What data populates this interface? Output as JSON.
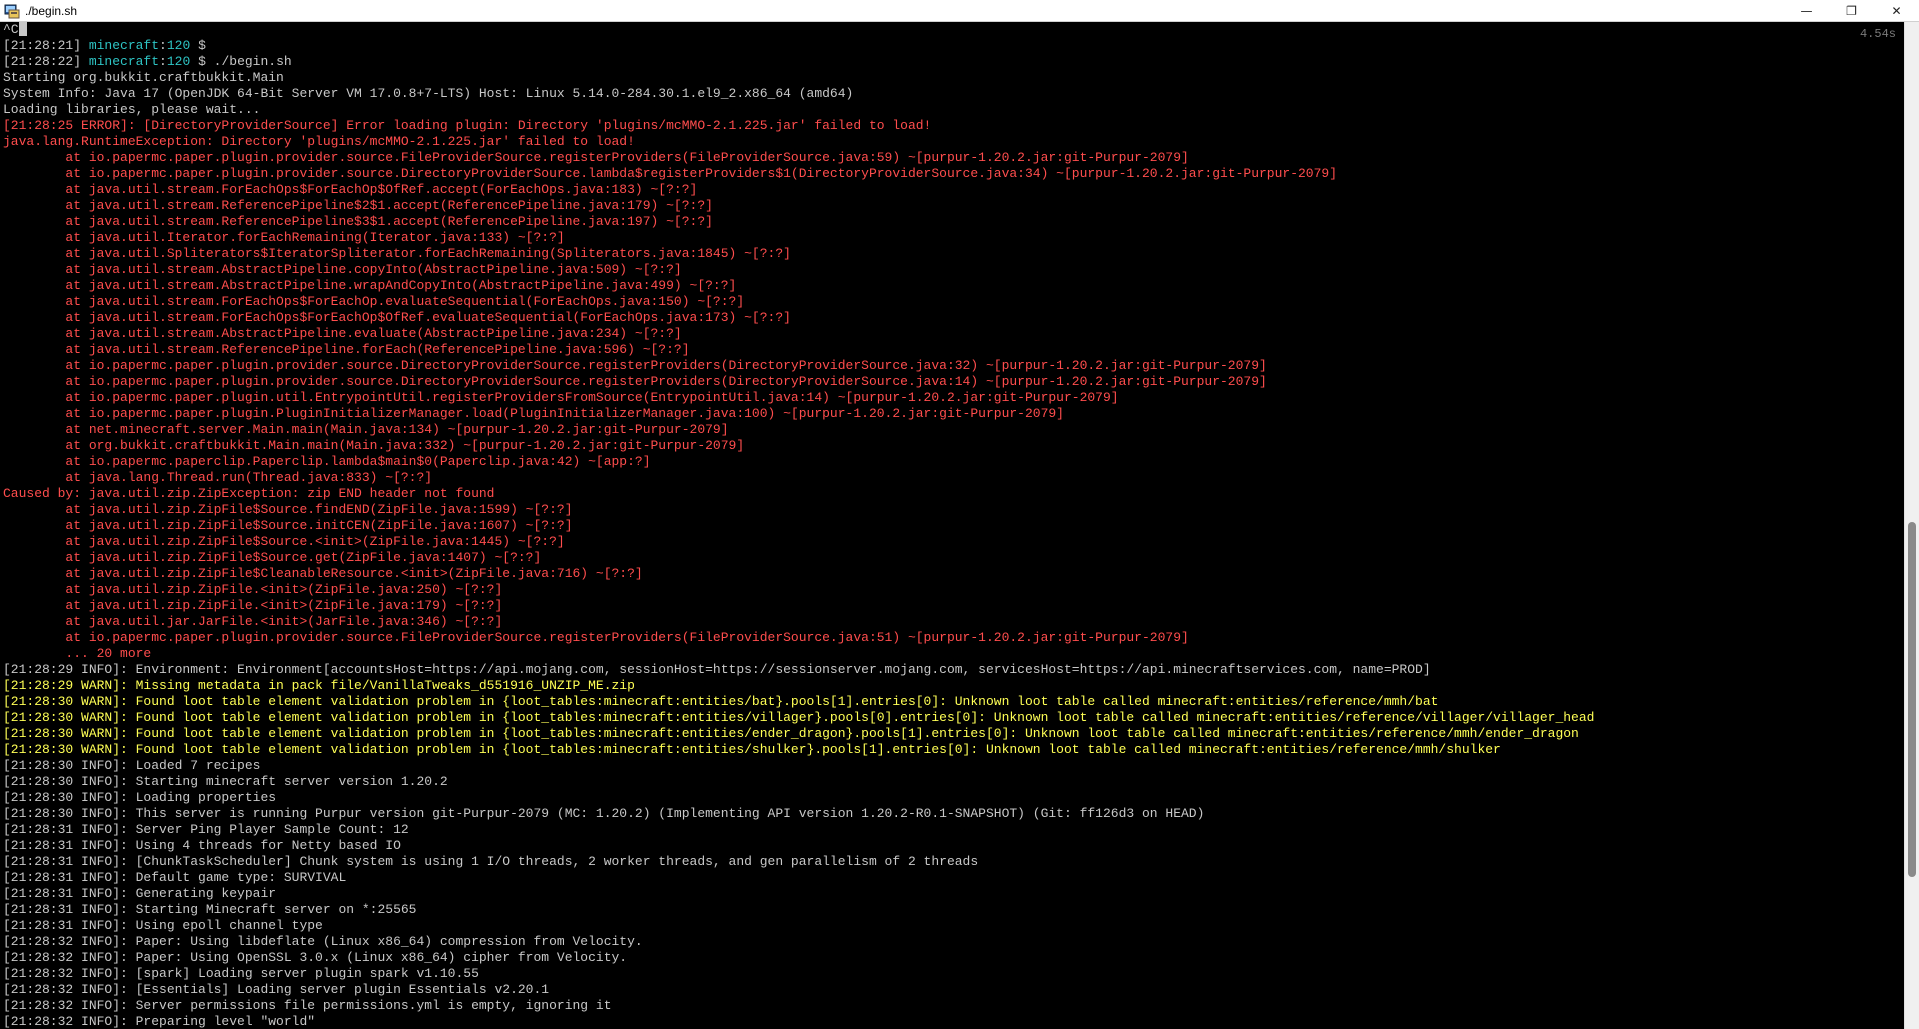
{
  "window": {
    "title": "./begin.sh",
    "minimize_glyph": "—",
    "maximize_glyph": "❐",
    "close_glyph": "✕"
  },
  "terminal": {
    "timer": "4.54s",
    "cursor_text": "^C",
    "lines": [
      {
        "segments": [
          {
            "t": "[21:28:21] ",
            "c": "default"
          },
          {
            "t": "minecraft",
            "c": "host"
          },
          {
            "t": ":",
            "c": "default"
          },
          {
            "t": "120",
            "c": "host"
          },
          {
            "t": " $",
            "c": "default"
          }
        ]
      },
      {
        "segments": [
          {
            "t": "[21:28:22] ",
            "c": "default"
          },
          {
            "t": "minecraft",
            "c": "host"
          },
          {
            "t": ":",
            "c": "default"
          },
          {
            "t": "120",
            "c": "host"
          },
          {
            "t": " $ ./begin.sh",
            "c": "default"
          }
        ]
      },
      {
        "segments": [
          {
            "t": "Starting org.bukkit.craftbukkit.Main",
            "c": "default"
          }
        ]
      },
      {
        "segments": [
          {
            "t": "System Info: Java 17 (OpenJDK 64-Bit Server VM 17.0.8+7-LTS) Host: Linux 5.14.0-284.30.1.el9_2.x86_64 (amd64)",
            "c": "default"
          }
        ]
      },
      {
        "segments": [
          {
            "t": "Loading libraries, please wait...",
            "c": "default"
          }
        ]
      },
      {
        "segments": [
          {
            "t": "[21:28:25 ERROR]: [DirectoryProviderSource] Error loading plugin: Directory 'plugins/mcMMO-2.1.225.jar' failed to load!",
            "c": "error"
          }
        ]
      },
      {
        "segments": [
          {
            "t": "java.lang.RuntimeException: Directory 'plugins/mcMMO-2.1.225.jar' failed to load!",
            "c": "error"
          }
        ]
      },
      {
        "segments": [
          {
            "t": "        at io.papermc.paper.plugin.provider.source.FileProviderSource.registerProviders(FileProviderSource.java:59) ~[purpur-1.20.2.jar:git-Purpur-2079]",
            "c": "error"
          }
        ]
      },
      {
        "segments": [
          {
            "t": "        at io.papermc.paper.plugin.provider.source.DirectoryProviderSource.lambda$registerProviders$1(DirectoryProviderSource.java:34) ~[purpur-1.20.2.jar:git-Purpur-2079]",
            "c": "error"
          }
        ]
      },
      {
        "segments": [
          {
            "t": "        at java.util.stream.ForEachOps$ForEachOp$OfRef.accept(ForEachOps.java:183) ~[?:?]",
            "c": "error"
          }
        ]
      },
      {
        "segments": [
          {
            "t": "        at java.util.stream.ReferencePipeline$2$1.accept(ReferencePipeline.java:179) ~[?:?]",
            "c": "error"
          }
        ]
      },
      {
        "segments": [
          {
            "t": "        at java.util.stream.ReferencePipeline$3$1.accept(ReferencePipeline.java:197) ~[?:?]",
            "c": "error"
          }
        ]
      },
      {
        "segments": [
          {
            "t": "        at java.util.Iterator.forEachRemaining(Iterator.java:133) ~[?:?]",
            "c": "error"
          }
        ]
      },
      {
        "segments": [
          {
            "t": "        at java.util.Spliterators$IteratorSpliterator.forEachRemaining(Spliterators.java:1845) ~[?:?]",
            "c": "error"
          }
        ]
      },
      {
        "segments": [
          {
            "t": "        at java.util.stream.AbstractPipeline.copyInto(AbstractPipeline.java:509) ~[?:?]",
            "c": "error"
          }
        ]
      },
      {
        "segments": [
          {
            "t": "        at java.util.stream.AbstractPipeline.wrapAndCopyInto(AbstractPipeline.java:499) ~[?:?]",
            "c": "error"
          }
        ]
      },
      {
        "segments": [
          {
            "t": "        at java.util.stream.ForEachOps$ForEachOp.evaluateSequential(ForEachOps.java:150) ~[?:?]",
            "c": "error"
          }
        ]
      },
      {
        "segments": [
          {
            "t": "        at java.util.stream.ForEachOps$ForEachOp$OfRef.evaluateSequential(ForEachOps.java:173) ~[?:?]",
            "c": "error"
          }
        ]
      },
      {
        "segments": [
          {
            "t": "        at java.util.stream.AbstractPipeline.evaluate(AbstractPipeline.java:234) ~[?:?]",
            "c": "error"
          }
        ]
      },
      {
        "segments": [
          {
            "t": "        at java.util.stream.ReferencePipeline.forEach(ReferencePipeline.java:596) ~[?:?]",
            "c": "error"
          }
        ]
      },
      {
        "segments": [
          {
            "t": "        at io.papermc.paper.plugin.provider.source.DirectoryProviderSource.registerProviders(DirectoryProviderSource.java:32) ~[purpur-1.20.2.jar:git-Purpur-2079]",
            "c": "error"
          }
        ]
      },
      {
        "segments": [
          {
            "t": "        at io.papermc.paper.plugin.provider.source.DirectoryProviderSource.registerProviders(DirectoryProviderSource.java:14) ~[purpur-1.20.2.jar:git-Purpur-2079]",
            "c": "error"
          }
        ]
      },
      {
        "segments": [
          {
            "t": "        at io.papermc.paper.plugin.util.EntrypointUtil.registerProvidersFromSource(EntrypointUtil.java:14) ~[purpur-1.20.2.jar:git-Purpur-2079]",
            "c": "error"
          }
        ]
      },
      {
        "segments": [
          {
            "t": "        at io.papermc.paper.plugin.PluginInitializerManager.load(PluginInitializerManager.java:100) ~[purpur-1.20.2.jar:git-Purpur-2079]",
            "c": "error"
          }
        ]
      },
      {
        "segments": [
          {
            "t": "        at net.minecraft.server.Main.main(Main.java:134) ~[purpur-1.20.2.jar:git-Purpur-2079]",
            "c": "error"
          }
        ]
      },
      {
        "segments": [
          {
            "t": "        at org.bukkit.craftbukkit.Main.main(Main.java:332) ~[purpur-1.20.2.jar:git-Purpur-2079]",
            "c": "error"
          }
        ]
      },
      {
        "segments": [
          {
            "t": "        at io.papermc.paperclip.Paperclip.lambda$main$0(Paperclip.java:42) ~[app:?]",
            "c": "error"
          }
        ]
      },
      {
        "segments": [
          {
            "t": "        at java.lang.Thread.run(Thread.java:833) ~[?:?]",
            "c": "error"
          }
        ]
      },
      {
        "segments": [
          {
            "t": "Caused by: java.util.zip.ZipException: zip END header not found",
            "c": "error"
          }
        ]
      },
      {
        "segments": [
          {
            "t": "        at java.util.zip.ZipFile$Source.findEND(ZipFile.java:1599) ~[?:?]",
            "c": "error"
          }
        ]
      },
      {
        "segments": [
          {
            "t": "        at java.util.zip.ZipFile$Source.initCEN(ZipFile.java:1607) ~[?:?]",
            "c": "error"
          }
        ]
      },
      {
        "segments": [
          {
            "t": "        at java.util.zip.ZipFile$Source.<init>(ZipFile.java:1445) ~[?:?]",
            "c": "error"
          }
        ]
      },
      {
        "segments": [
          {
            "t": "        at java.util.zip.ZipFile$Source.get(ZipFile.java:1407) ~[?:?]",
            "c": "error"
          }
        ]
      },
      {
        "segments": [
          {
            "t": "        at java.util.zip.ZipFile$CleanableResource.<init>(ZipFile.java:716) ~[?:?]",
            "c": "error"
          }
        ]
      },
      {
        "segments": [
          {
            "t": "        at java.util.zip.ZipFile.<init>(ZipFile.java:250) ~[?:?]",
            "c": "error"
          }
        ]
      },
      {
        "segments": [
          {
            "t": "        at java.util.zip.ZipFile.<init>(ZipFile.java:179) ~[?:?]",
            "c": "error"
          }
        ]
      },
      {
        "segments": [
          {
            "t": "        at java.util.jar.JarFile.<init>(JarFile.java:346) ~[?:?]",
            "c": "error"
          }
        ]
      },
      {
        "segments": [
          {
            "t": "        at io.papermc.paper.plugin.provider.source.FileProviderSource.registerProviders(FileProviderSource.java:51) ~[purpur-1.20.2.jar:git-Purpur-2079]",
            "c": "error"
          }
        ]
      },
      {
        "segments": [
          {
            "t": "        ... 20 more",
            "c": "error"
          }
        ]
      },
      {
        "segments": [
          {
            "t": "[21:28:29 INFO]: Environment: Environment[accountsHost=https://api.mojang.com, sessionHost=https://sessionserver.mojang.com, servicesHost=https://api.minecraftservices.com, name=PROD]",
            "c": "default"
          }
        ]
      },
      {
        "segments": [
          {
            "t": "[21:28:29 WARN]: Missing metadata in pack file/VanillaTweaks_d551916_UNZIP_ME.zip",
            "c": "warn"
          }
        ]
      },
      {
        "segments": [
          {
            "t": "[21:28:30 WARN]: Found loot table element validation problem in {loot_tables:minecraft:entities/bat}.pools[1].entries[0]: Unknown loot table called minecraft:entities/reference/mmh/bat",
            "c": "warn"
          }
        ]
      },
      {
        "segments": [
          {
            "t": "[21:28:30 WARN]: Found loot table element validation problem in {loot_tables:minecraft:entities/villager}.pools[0].entries[0]: Unknown loot table called minecraft:entities/reference/villager/villager_head",
            "c": "warn"
          }
        ]
      },
      {
        "segments": [
          {
            "t": "[21:28:30 WARN]: Found loot table element validation problem in {loot_tables:minecraft:entities/ender_dragon}.pools[1].entries[0]: Unknown loot table called minecraft:entities/reference/mmh/ender_dragon",
            "c": "warn"
          }
        ]
      },
      {
        "segments": [
          {
            "t": "[21:28:30 WARN]: Found loot table element validation problem in {loot_tables:minecraft:entities/shulker}.pools[1].entries[0]: Unknown loot table called minecraft:entities/reference/mmh/shulker",
            "c": "warn"
          }
        ]
      },
      {
        "segments": [
          {
            "t": "[21:28:30 INFO]: Loaded 7 recipes",
            "c": "default"
          }
        ]
      },
      {
        "segments": [
          {
            "t": "[21:28:30 INFO]: Starting minecraft server version 1.20.2",
            "c": "default"
          }
        ]
      },
      {
        "segments": [
          {
            "t": "[21:28:30 INFO]: Loading properties",
            "c": "default"
          }
        ]
      },
      {
        "segments": [
          {
            "t": "[21:28:30 INFO]: This server is running Purpur version git-Purpur-2079 (MC: 1.20.2) (Implementing API version 1.20.2-R0.1-SNAPSHOT) (Git: ff126d3 on HEAD)",
            "c": "default"
          }
        ]
      },
      {
        "segments": [
          {
            "t": "[21:28:31 INFO]: Server Ping Player Sample Count: 12",
            "c": "default"
          }
        ]
      },
      {
        "segments": [
          {
            "t": "[21:28:31 INFO]: Using 4 threads for Netty based IO",
            "c": "default"
          }
        ]
      },
      {
        "segments": [
          {
            "t": "[21:28:31 INFO]: [ChunkTaskScheduler] Chunk system is using 1 I/O threads, 2 worker threads, and gen parallelism of 2 threads",
            "c": "default"
          }
        ]
      },
      {
        "segments": [
          {
            "t": "[21:28:31 INFO]: Default game type: SURVIVAL",
            "c": "default"
          }
        ]
      },
      {
        "segments": [
          {
            "t": "[21:28:31 INFO]: Generating keypair",
            "c": "default"
          }
        ]
      },
      {
        "segments": [
          {
            "t": "[21:28:31 INFO]: Starting Minecraft server on *:25565",
            "c": "default"
          }
        ]
      },
      {
        "segments": [
          {
            "t": "[21:28:31 INFO]: Using epoll channel type",
            "c": "default"
          }
        ]
      },
      {
        "segments": [
          {
            "t": "[21:28:32 INFO]: Paper: Using libdeflate (Linux x86_64) compression from Velocity.",
            "c": "default"
          }
        ]
      },
      {
        "segments": [
          {
            "t": "[21:28:32 INFO]: Paper: Using OpenSSL 3.0.x (Linux x86_64) cipher from Velocity.",
            "c": "default"
          }
        ]
      },
      {
        "segments": [
          {
            "t": "[21:28:32 INFO]: [spark] Loading server plugin spark v1.10.55",
            "c": "default"
          }
        ]
      },
      {
        "segments": [
          {
            "t": "[21:28:32 INFO]: [Essentials] Loading server plugin Essentials v2.20.1",
            "c": "default"
          }
        ]
      },
      {
        "segments": [
          {
            "t": "[21:28:32 INFO]: Server permissions file permissions.yml is empty, ignoring it",
            "c": "default"
          }
        ]
      },
      {
        "segments": [
          {
            "t": "[21:28:32 INFO]: Preparing level \"world\"",
            "c": "default"
          }
        ]
      }
    ]
  }
}
